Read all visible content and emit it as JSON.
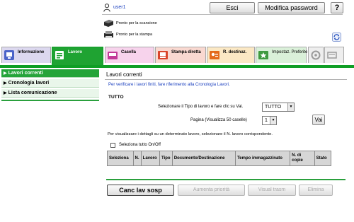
{
  "header": {
    "username": "user1",
    "logout_label": "Esci",
    "change_password_label": "Modifica password",
    "help_label": "?"
  },
  "status": {
    "scan": "Pronto per la scansione",
    "print": "Pronto per la stampa"
  },
  "tabs": [
    {
      "label": "Informazione",
      "color": "#dcd8ef",
      "icon": "information-icon"
    },
    {
      "label": "Lavoro",
      "color": "#1fa332",
      "icon": "job-icon",
      "active": true
    },
    {
      "label": "Casella",
      "color": "#f7d3ec",
      "icon": "box-icon"
    },
    {
      "label": "Stampa diretta",
      "color": "#f9d8d0",
      "icon": "direct-print-icon"
    },
    {
      "label": "R. destinaz.",
      "color": "#fbe8c4",
      "icon": "address-book-icon"
    },
    {
      "label": "Impostaz. Preferite",
      "color": "#daf0d9",
      "icon": "favorite-settings-icon"
    }
  ],
  "sidebar": {
    "items": [
      {
        "label": "Lavori correnti",
        "active": true
      },
      {
        "label": "Cronologia lavori",
        "active": false
      },
      {
        "label": "Lista comunicazione",
        "active": false
      }
    ]
  },
  "main": {
    "title": "Lavori correnti",
    "info": "Per verificare i lavori finiti, fare riferimento alla Cronologia Lavori.",
    "filter_heading": "TUTTO",
    "job_type_label": "Selezionare il Tipo di lavoro e fare clic su Vai.",
    "job_type_value": "TUTTO",
    "page_label": "Pagina (Visualizza 50 caselle)",
    "page_value": "1",
    "go_label": "Vai",
    "details_hint": "Per visualizzare i dettagli su un determinato lavoro, selezionare il N. lavoro corrispondente.",
    "select_all_label": "Seleziona tutto On/Off",
    "table_headers": [
      "Seleziona",
      "N.",
      "Lavoro",
      "Tipo",
      "Documento/Destinazione",
      "Tempo immagazzinato",
      "N. di copie",
      "Stato"
    ]
  },
  "actions": {
    "cancel_job": "Canc lav sosp",
    "raise_priority": "Aumenta priorità",
    "view_transmission": "Visual trasm",
    "delete": "Elimina"
  },
  "colors": {
    "accent_green": "#1fa332",
    "link_blue": "#1a3fbf"
  }
}
